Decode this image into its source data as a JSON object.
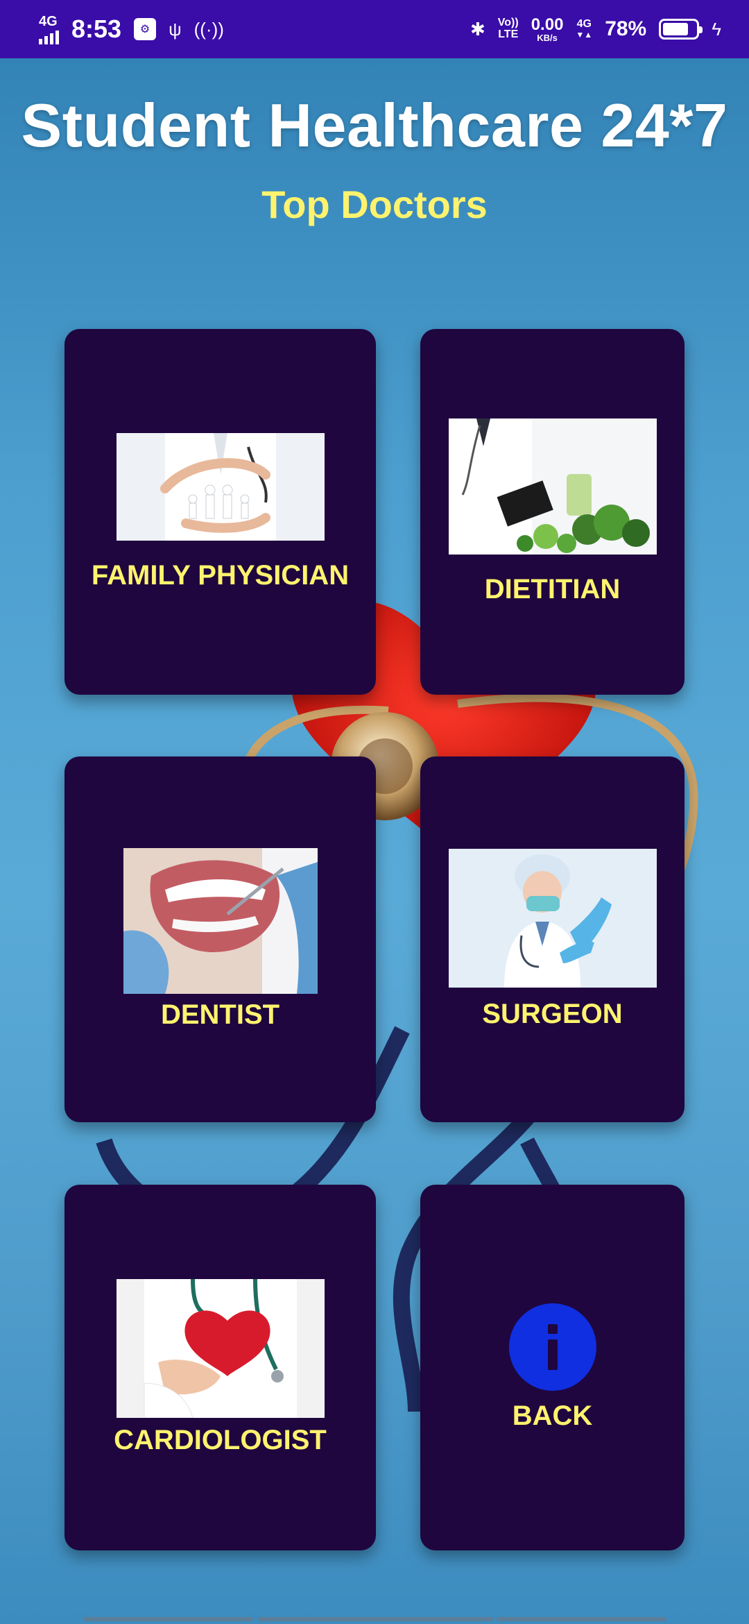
{
  "status_bar": {
    "network": "4G",
    "time": "8:53",
    "volte_top": "Vo))",
    "volte_bottom": "LTE",
    "speed_value": "0.00",
    "speed_unit": "KB/s",
    "network2": "4G",
    "battery_percent": "78%",
    "battery_level": 0.78
  },
  "header": {
    "title": "Student Healthcare 24*7",
    "subtitle": "Top Doctors"
  },
  "cards": {
    "family_physician": {
      "label": "FAMILY PHYSICIAN",
      "icon": "family-care-photo"
    },
    "dietitian": {
      "label": "DIETITIAN",
      "icon": "doctor-vegetables-photo"
    },
    "dentist": {
      "label": "DENTIST",
      "icon": "dental-exam-photo"
    },
    "surgeon": {
      "label": "SURGEON",
      "icon": "surgeon-gloves-photo"
    },
    "cardiologist": {
      "label": "CARDIOLOGIST",
      "icon": "heart-in-hand-photo"
    },
    "back": {
      "label": "BACK",
      "icon": "info-icon"
    }
  },
  "colors": {
    "status_bar": "#3a0ca8",
    "card_bg": "#1f063f",
    "label_yellow": "#fff36e",
    "info_blue": "#0f2fe0"
  }
}
